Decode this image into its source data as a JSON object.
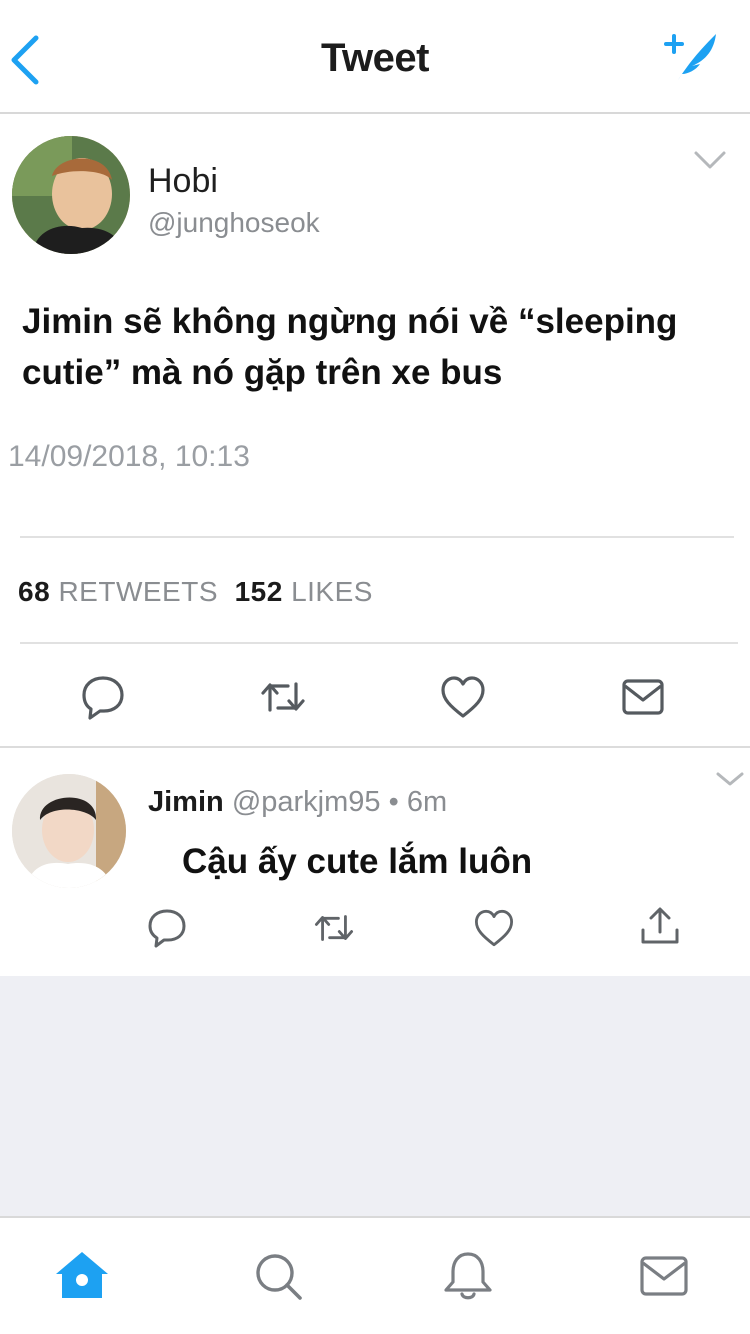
{
  "header": {
    "title": "Tweet",
    "back_icon": "chevron-left-icon",
    "compose_icon": "compose-tweet-icon",
    "accent": "#1da1f2"
  },
  "tweet": {
    "author": {
      "name": "Hobi",
      "handle": "@junghoseok"
    },
    "text": "Jimin sẽ không ngừng nói về “sleeping cutie” mà nó gặp trên xe bus",
    "timestamp": "14/09/2018, 10:13",
    "stats": {
      "retweets_count": "68",
      "retweets_label": "RETWEETS",
      "likes_count": "152",
      "likes_label": "LIKES"
    },
    "actions": [
      "reply-icon",
      "retweet-icon",
      "like-icon",
      "direct-message-icon"
    ]
  },
  "reply": {
    "author": {
      "name": "Jimin",
      "handle": "@parkjm95",
      "separator": "•",
      "age": "6m"
    },
    "text": "Cậu ấy cute lắm luôn",
    "actions": [
      "reply-icon",
      "retweet-icon",
      "like-icon",
      "share-icon"
    ]
  },
  "tabbar": {
    "items": [
      "home-icon",
      "search-icon",
      "notifications-icon",
      "messages-icon"
    ],
    "active": "home-icon",
    "active_color": "#1da1f2"
  }
}
